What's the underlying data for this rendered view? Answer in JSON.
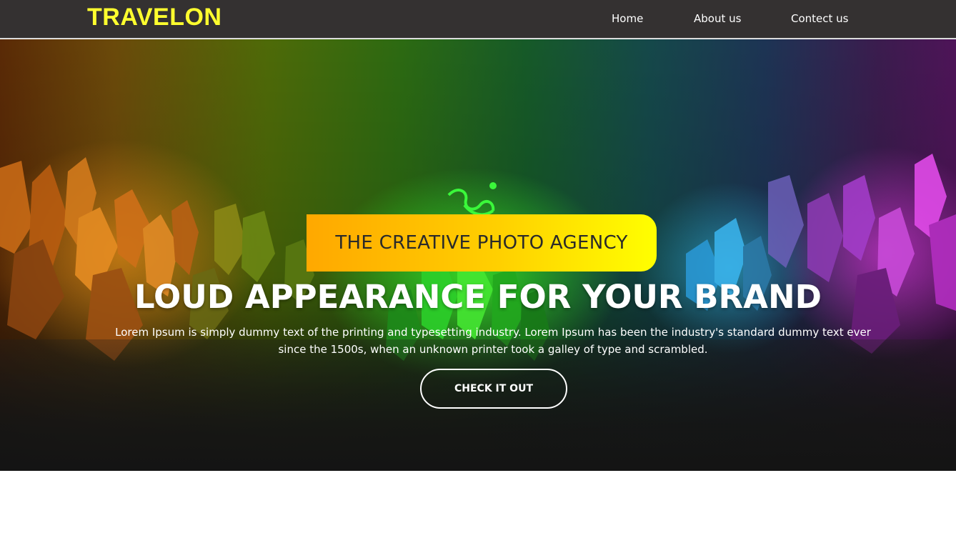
{
  "header": {
    "brand": "TRAVELON",
    "nav": [
      {
        "label": "Home"
      },
      {
        "label": "About us"
      },
      {
        "label": "Contect us"
      }
    ]
  },
  "hero": {
    "tagline": "THE CREATIVE PHOTO AGENCY",
    "headline": "LOUD APPEARANCE FOR YOUR BRAND",
    "description": "Lorem Ipsum is simply dummy text of the printing and typesetting industry. Lorem Ipsum has been the industry's standard dummy text ever since the 1500s, when an unknown printer took a galley of type and scrambled.",
    "cta_label": "CHECK IT OUT"
  },
  "colors": {
    "navbar_bg": "#343131",
    "brand": "#ffff2e",
    "tagline_gradient_start": "#ffa800",
    "tagline_gradient_end": "#ffff00",
    "text": "#ffffff"
  },
  "icons": {
    "logo_mark": "snake-logo-icon"
  }
}
